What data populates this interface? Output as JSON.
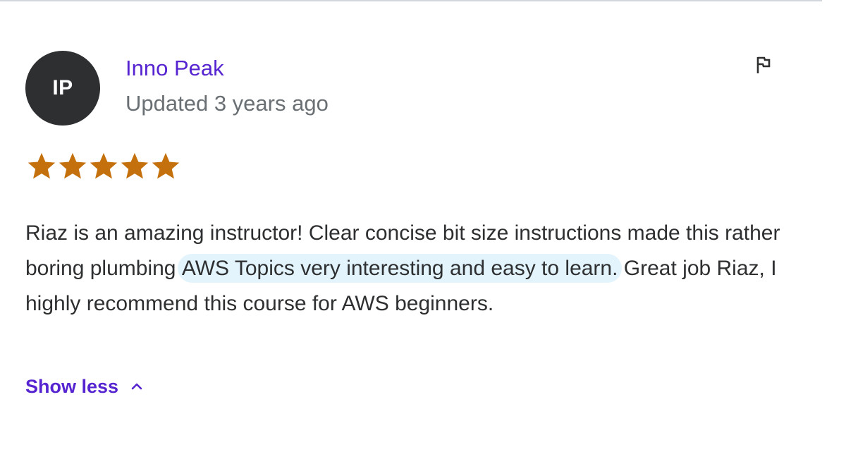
{
  "review": {
    "avatar_initials": "IP",
    "reviewer_name": "Inno Peak",
    "date": "Updated 3 years ago",
    "rating": 5,
    "rating_max": 5,
    "text_part1": "Riaz is an amazing instructor! Clear concise bit size instructions made this rather boring plumbing ",
    "text_highlight": "AWS Topics very interesting and easy to learn.",
    "text_part2": " Great job Riaz, I highly recommend this course for AWS beginners.",
    "show_less_label": "Show less"
  },
  "icons": {
    "flag": "flag-icon",
    "star": "star-icon",
    "chevron": "chevron-up-icon"
  },
  "colors": {
    "avatar_bg": "#2d2f31",
    "link": "#5624d0",
    "star": "#c4710d",
    "muted": "#6a6f73",
    "text": "#2d2f31",
    "highlight": "#e3f4fd"
  }
}
